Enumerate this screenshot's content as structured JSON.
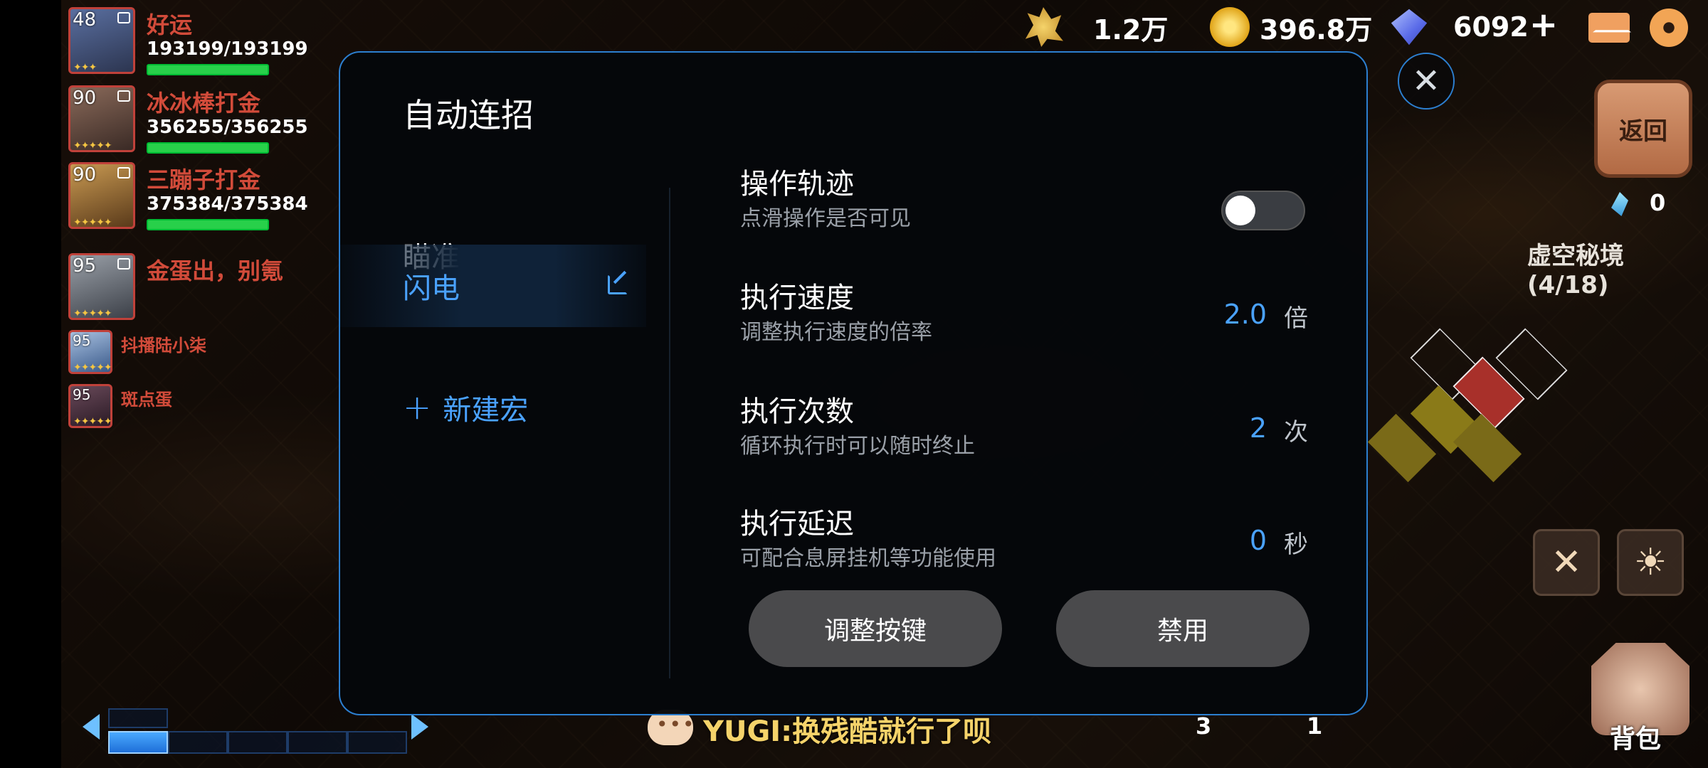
{
  "party": [
    {
      "level": "48",
      "name": "好运",
      "hp": "193199/193199",
      "hp_fraction": 1.0
    },
    {
      "level": "90",
      "name": "冰冰棒打金",
      "hp": "356255/356255",
      "hp_fraction": 1.0
    },
    {
      "level": "90",
      "name": "三蹦子打金",
      "hp": "375384/375384",
      "hp_fraction": 1.0
    },
    {
      "level": "95",
      "name": "金蛋出，别氪"
    },
    {
      "level": "95",
      "name": "抖播陆小柒"
    },
    {
      "level": "95",
      "name": "斑点蛋"
    }
  ],
  "resources": {
    "wheat": "1.2万",
    "gold": "396.8万",
    "diamond": "6092",
    "plus_symbol": "+",
    "crystal": "0"
  },
  "hud": {
    "back_label": "返回",
    "dungeon": "虚空秘境 (4/18)",
    "bag_label": "背包",
    "chat_message": "YUGI:换残酷就行了呗",
    "count_left": "3",
    "count_right": "1"
  },
  "modal": {
    "title": "自动连招",
    "close_symbol": "✕",
    "nav": [
      {
        "label": "瞄准",
        "active": false
      },
      {
        "label": "闪电",
        "active": true
      }
    ],
    "new_macro": "新建宏",
    "new_macro_symbol": "+",
    "settings": [
      {
        "title": "操作轨迹",
        "desc": "点滑操作是否可见",
        "toggle_on": false
      },
      {
        "title": "执行速度",
        "desc": "调整执行速度的倍率",
        "value": "2.0",
        "unit": "倍"
      },
      {
        "title": "执行次数",
        "desc": "循环执行时可以随时终止",
        "value": "2",
        "unit": "次"
      },
      {
        "title": "执行延迟",
        "desc": "可配合息屏挂机等功能使用",
        "value": "0",
        "unit": "秒"
      }
    ],
    "buttons": {
      "adjust": "调整按键",
      "disable": "禁用"
    }
  },
  "colors": {
    "accent": "#4aa2ff",
    "border": "#2c7fd0",
    "name_red": "#d24b3a",
    "hp_green": "#28d04a"
  },
  "icons": [
    "wheat-icon",
    "coin-icon",
    "diamond-icon",
    "plus-icon",
    "mail-icon",
    "gear-icon",
    "close-icon",
    "edit-icon",
    "plus-icon",
    "crystal-icon",
    "chat-icon",
    "bag-icon",
    "skill-icon",
    "hint-icon"
  ]
}
